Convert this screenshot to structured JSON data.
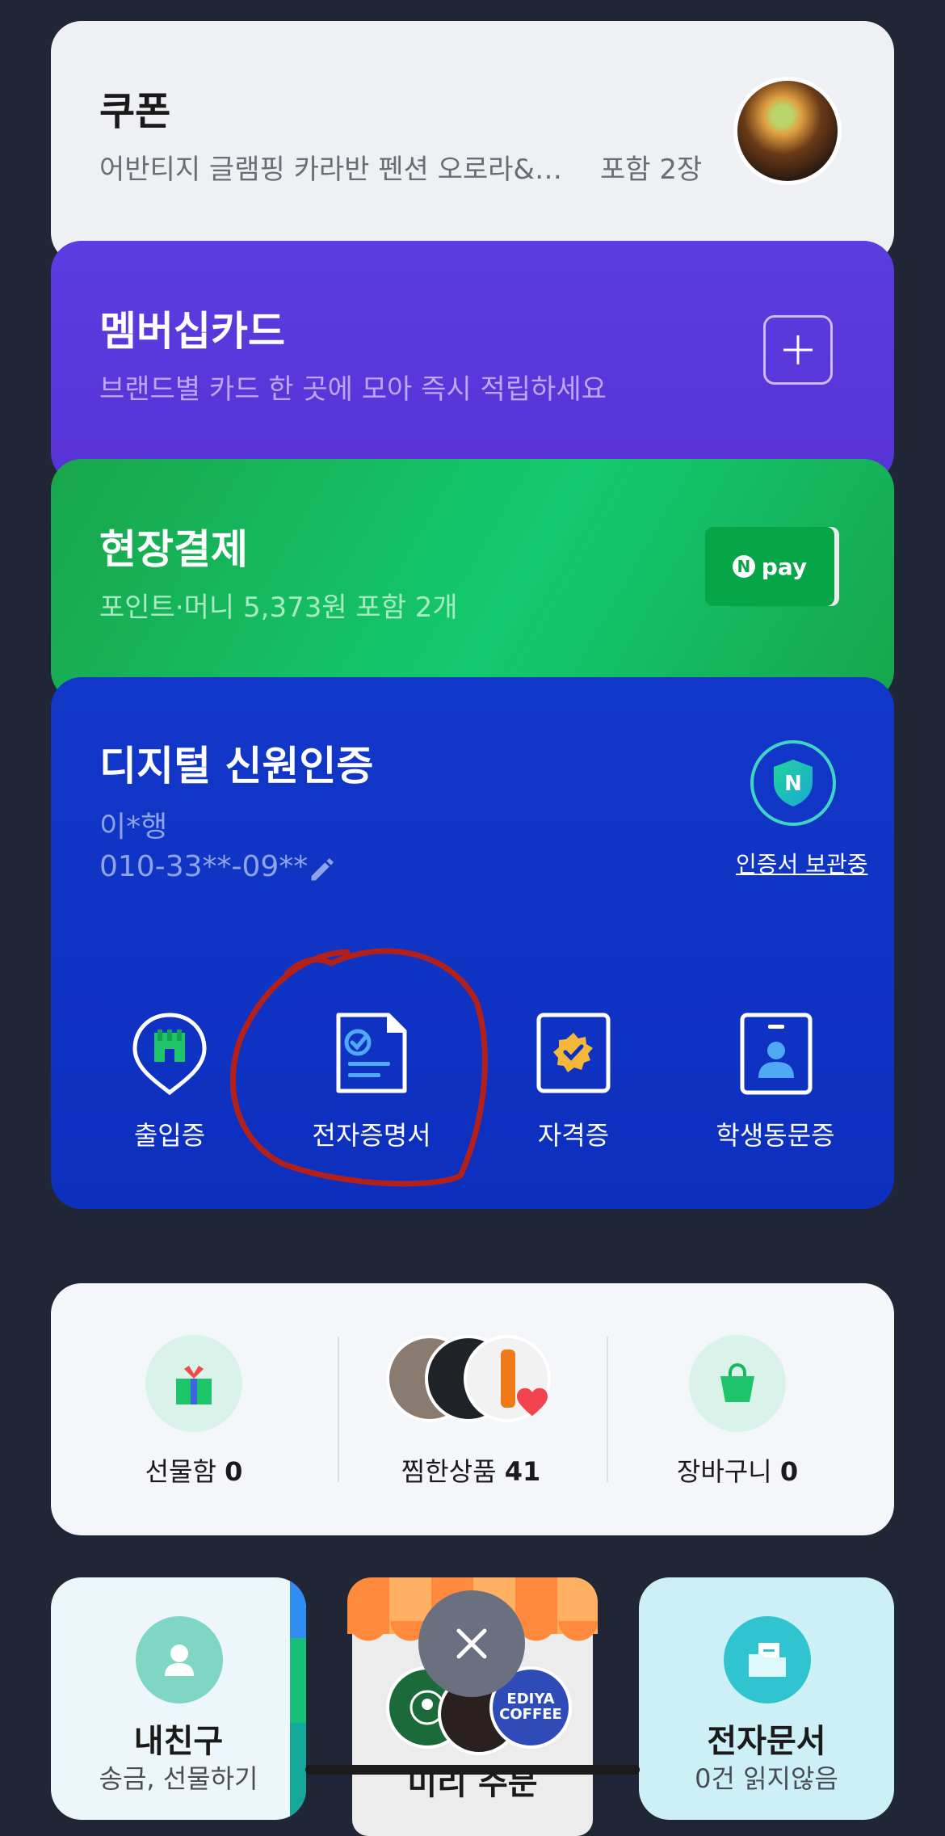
{
  "coupon": {
    "title": "쿠폰",
    "subtitle": "어반티지 글램핑 카라반 펜션 오로라&…",
    "count": "포함 2장"
  },
  "membership": {
    "title": "멤버십카드",
    "subtitle": "브랜드별 카드 한 곳에 모아 즉시 적립하세요",
    "add_icon": "plus-icon"
  },
  "onsite_payment": {
    "title": "현장결제",
    "subtitle": "포인트·머니 5,373원 포함 2개",
    "npay_letter": "N",
    "npay_label": "pay"
  },
  "digital_id": {
    "title": "디지털 신원인증",
    "name": "이*행",
    "phone": "010-33**-09**",
    "shield_letter": "N",
    "cert_link": "인증서 보관중",
    "buttons": [
      {
        "label": "출입증",
        "icon": "entry-pass-icon"
      },
      {
        "label": "전자증명서",
        "icon": "e-certificate-icon"
      },
      {
        "label": "자격증",
        "icon": "license-icon"
      },
      {
        "label": "학생동문증",
        "icon": "student-id-icon"
      }
    ]
  },
  "shopping": {
    "gift": {
      "label": "선물함",
      "count": "0"
    },
    "wishlist": {
      "label": "찜한상품",
      "count": "41"
    },
    "cart": {
      "label": "장바구니",
      "count": "0"
    }
  },
  "tiles": {
    "friends": {
      "title": "내친구",
      "subtitle": "송금, 선물하기"
    },
    "preorder": {
      "title": "미리 주문",
      "logo_ediya": "EDIYA COFFEE"
    },
    "edocs": {
      "title": "전자문서",
      "subtitle": "0건 읽지않음"
    }
  },
  "colors": {
    "membership": "#5b3ce0",
    "onsite": "#13c96f",
    "digital": "#1238c9",
    "annotation": "#b3201a"
  }
}
